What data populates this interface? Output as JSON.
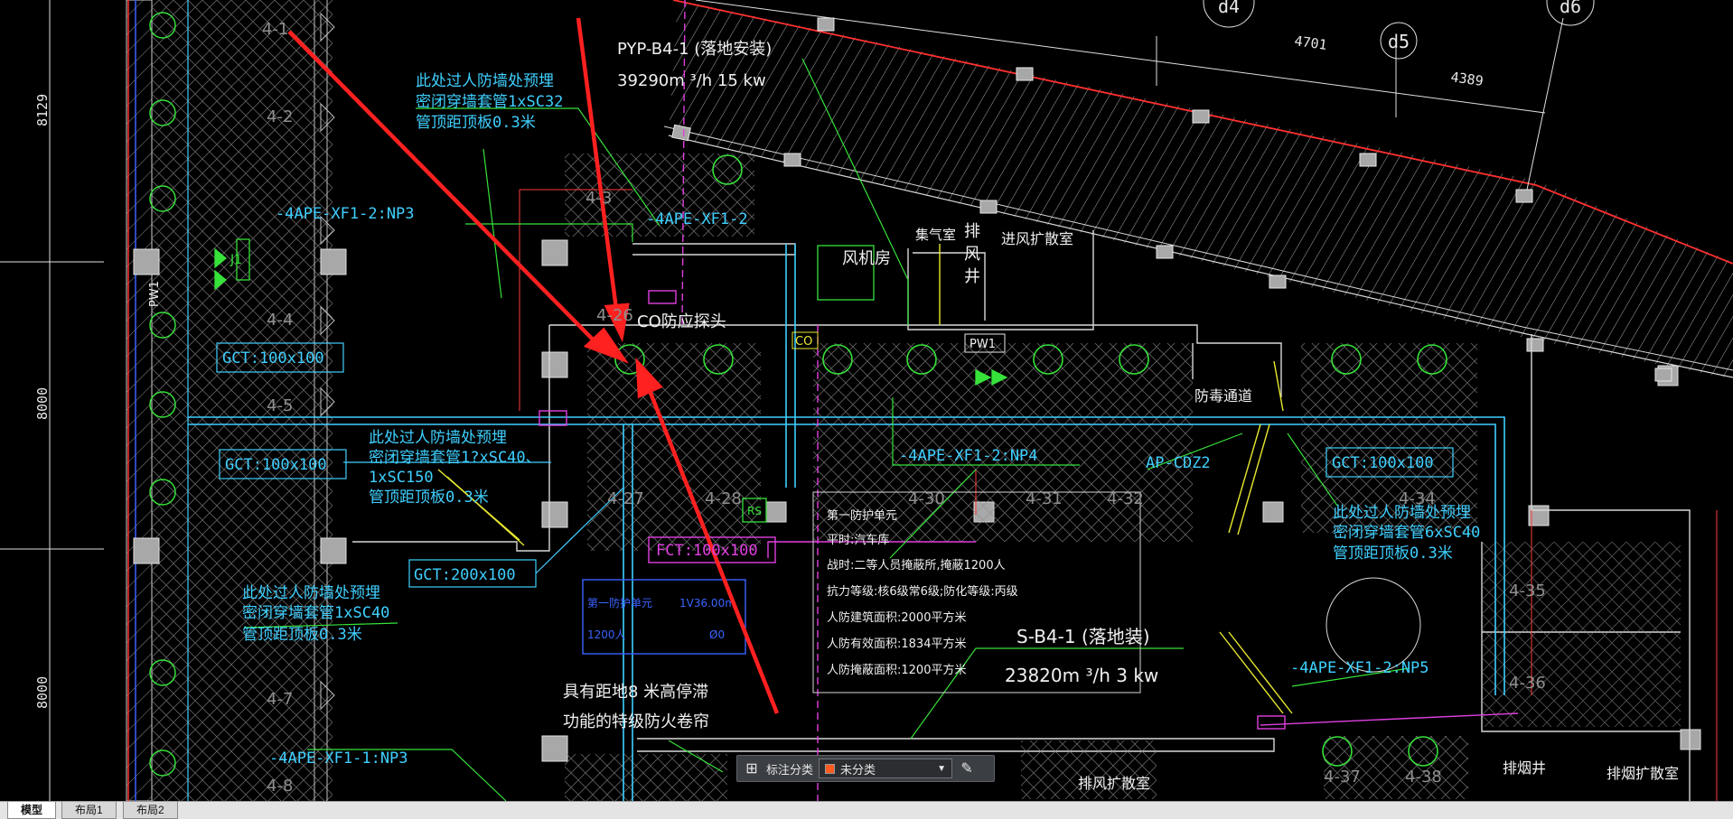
{
  "colors": {
    "background": "#000000",
    "cyan": "#3fd0ff",
    "green": "#36e23a",
    "red_arrow": "#ff2020",
    "magenta": "#e040e0",
    "blue": "#3b63ff",
    "yellow": "#e8e830",
    "hatch": "#9a9a9a"
  },
  "drawing": {
    "dims": {
      "d1": "8129",
      "d2": "8000",
      "d3": "8000",
      "top1": "4701",
      "top2": "4389",
      "axis_d4": "d4",
      "axis_d5": "d5",
      "axis_d6": "d6"
    },
    "fans": {
      "pyp_title": "PYP-B4-1  (落地安装)",
      "pyp_spec": "39290m  ³/h   15   kw",
      "sb4_title": "S-B4-1  (落地装)",
      "sb4_spec": "23820m  ³/h    3 kw"
    },
    "notes": {
      "n1_l1": "此处过人防墙处预埋",
      "n1_l2": "密闭穿墙套管1xSC32",
      "n1_l3": "管顶距顶板0.3米",
      "n2_l1": "此处过人防墙处预埋",
      "n2_l2": "密闭穿墙套管1?xSC40、",
      "n2_l3": "1xSC150",
      "n2_l4": "管顶距顶板0.3米",
      "n3_l1": "此处过人防墙处预埋",
      "n3_l2": "密闭穿墙套管1xSC40",
      "n3_l3": "管顶距顶板0.3米",
      "n4_l1": "此处过人防墙处预埋",
      "n4_l2": "密闭穿墙套管6xSC40",
      "n4_l3": "管顶距顶板0.3米",
      "shutter_l1": "具有距地8  米高停滞",
      "shutter_l2": "功能的特级防火卷帘",
      "co_probe": "CO防应探头"
    },
    "panels": {
      "ape1": "-4APE-XF1-2:NP3",
      "ape2": "-4APE-XF1-2",
      "ape3": "-4APE-XF1-2:NP4",
      "ape4": "-4APE-XF1-2:NP5",
      "ape5": "-4APE-XF1-1:NP3",
      "ap": "AP-CDZ2",
      "pw1": "PW1",
      "pw1_side": "PW1",
      "co": "CO",
      "rs": "RS",
      "j1": "J1"
    },
    "ducts": {
      "gct1": "GCT:100x100",
      "gct2": "GCT:100x100",
      "gct3": "GCT:200x100",
      "gct4": "GCT:100x100",
      "fct": "FCT:100x100"
    },
    "rooms": {
      "fan_room": "风机房",
      "exhaust_shaft_l1": "排",
      "exhaust_shaft_l2": "风",
      "exhaust_shaft_l3": "井",
      "collect_room": "集气室",
      "intake_room": "进风扩散室",
      "anti_gas": "防毒通道",
      "exhaust_diff": "排风扩散室",
      "smoke_shaft": "排烟井",
      "smoke_diff": "排烟扩散室"
    },
    "civil_defense": {
      "title": "第一防护单元",
      "l1": "平时:汽车库",
      "l2": "战时:二等人员掩蔽所,掩蔽1200人",
      "l3": "抗力等级:核6级常6级;防化等级:丙级",
      "l4": "人防建筑面积:2000平方米",
      "l5": "人防有效面积:1834平方米",
      "l6": "人防掩蔽面积:1200平方米"
    },
    "blue_box": {
      "t1": "第一防护单元",
      "t2": "1V36.00m",
      "t3": "1200人",
      "t4": "Ø0"
    },
    "parking": [
      "4-1",
      "4-2",
      "4-3",
      "4-4",
      "4-5",
      "4-7",
      "4-8",
      "4-26",
      "4-27",
      "4-28",
      "4-30",
      "4-31",
      "4-32",
      "4-34",
      "4-35",
      "4-36",
      "4-37",
      "4-38"
    ]
  },
  "annotation_toolbar": {
    "label": "标注分类",
    "selected": "未分类",
    "selected_color": "#ff5a1f"
  },
  "tabs": [
    "模型",
    "布局1",
    "布局2"
  ]
}
